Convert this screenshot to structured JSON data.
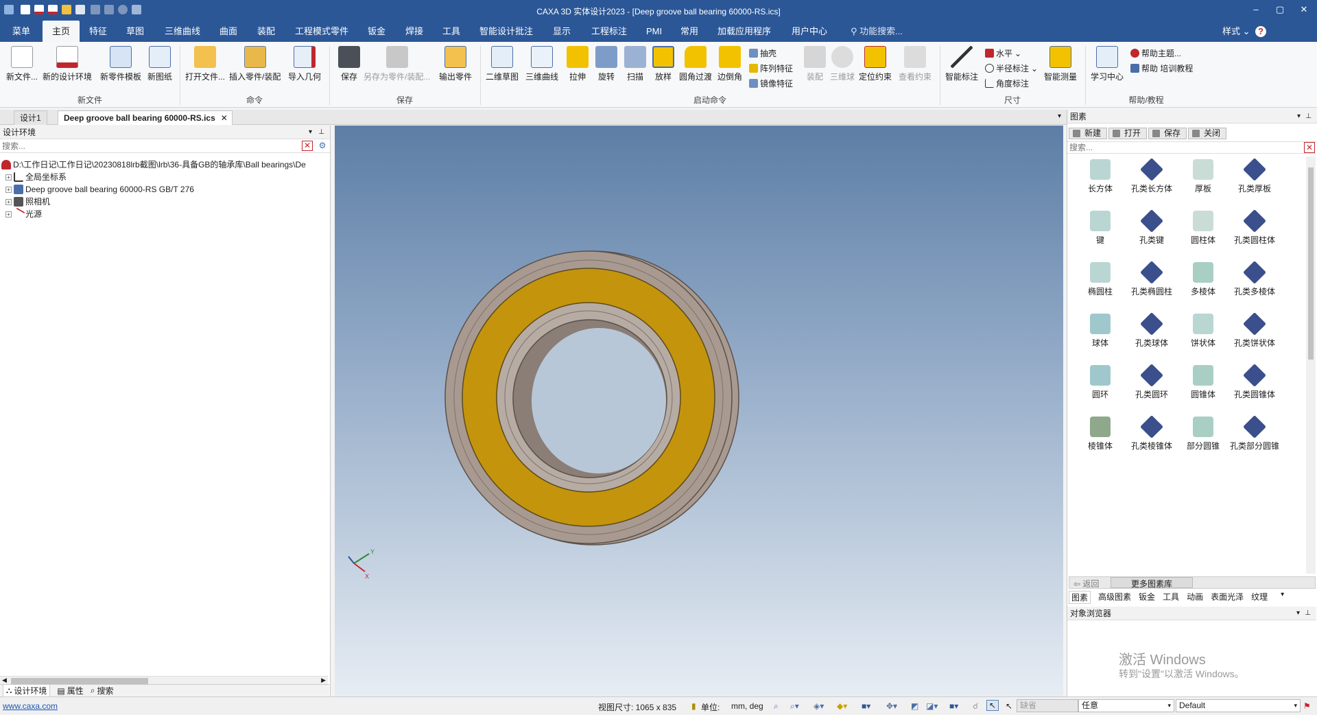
{
  "window": {
    "title": "CAXA 3D 实体设计2023 - [Deep groove ball bearing 60000-RS.ics]",
    "controls": [
      "–",
      "▢",
      "✕"
    ]
  },
  "menu": {
    "tabs": [
      "菜单",
      "主页",
      "特征",
      "草图",
      "三维曲线",
      "曲面",
      "装配",
      "工程模式零件",
      "钣金",
      "焊接",
      "工具",
      "智能设计批注",
      "显示",
      "工程标注",
      "PMI",
      "常用",
      "加载应用程序",
      "用户中心"
    ],
    "active_tab": "主页",
    "search_placeholder": "功能搜索...",
    "style_label": "样式"
  },
  "ribbon": {
    "buttons": {
      "new_file": "新文件...",
      "new_design_env": "新的设计环境",
      "new_part_template": "新零件模板",
      "new_drawing": "新图纸",
      "open_file": "打开文件...",
      "insert_part": "插入零件/装配",
      "import_geometry": "导入几何",
      "save": "保存",
      "save_as_part": "另存为零件/装配...",
      "export_part": "输出零件",
      "sketch_2d": "二维草图",
      "curve_3d": "三维曲线",
      "extrude": "拉伸",
      "revolve": "旋转",
      "sweep": "扫描",
      "loft": "放样",
      "fillet": "圆角过渡",
      "chamfer": "边倒角",
      "shell": "抽壳",
      "pattern": "阵列特征",
      "mirror": "镜像特征",
      "assembly": "装配",
      "ball_3d": "三维球",
      "position_constraint": "定位约束",
      "view_constraint": "查看约束",
      "smart_dimension": "智能标注",
      "horizontal": "水平",
      "radius_dim": "半径标注",
      "angle_dim": "角度标注",
      "smart_measure": "智能测量",
      "learning_center": "学习中心",
      "help_topics": "帮助主题...",
      "help_training": "帮助 培训教程"
    },
    "groups": {
      "new_file": "新文件",
      "command": "命令",
      "save": "保存",
      "launch": "启动命令",
      "dimension": "尺寸",
      "help": "帮助/教程"
    }
  },
  "doc_tabs": [
    {
      "label": "设计1",
      "active": false
    },
    {
      "label": "Deep groove ball bearing 60000-RS.ics",
      "active": true
    }
  ],
  "left_panel": {
    "title": "设计环境",
    "search_placeholder": "搜索...",
    "tree": [
      "D:\\工作日记\\工作日记\\20230818lrb截图\\lrb\\36-具备GB的轴承库\\Ball bearings\\De",
      "全局坐标系",
      "Deep groove ball bearing 60000-RS GB/T 276",
      "照相机",
      "光源"
    ],
    "footer_tabs": [
      "设计环境",
      "属性",
      "搜索"
    ]
  },
  "right_panel": {
    "title": "图素",
    "buttons": [
      "新建",
      "打开",
      "保存",
      "关闭"
    ],
    "search_placeholder": "搜索...",
    "items": [
      {
        "label": "长方体",
        "color": "#b9d6d3"
      },
      {
        "label": "孔类长方体",
        "color": "#3b4f8c"
      },
      {
        "label": "厚板",
        "color": "#c9ddd6"
      },
      {
        "label": "孔类厚板",
        "color": "#3b4f8c"
      },
      {
        "label": "键",
        "color": "#b9d6d3"
      },
      {
        "label": "孔类键",
        "color": "#3b4f8c"
      },
      {
        "label": "圆柱体",
        "color": "#c9ddd6"
      },
      {
        "label": "孔类圆柱体",
        "color": "#3b4f8c"
      },
      {
        "label": "椭圆柱",
        "color": "#b9d6d3"
      },
      {
        "label": "孔类椭圆柱",
        "color": "#3b4f8c"
      },
      {
        "label": "多棱体",
        "color": "#a9cfc4"
      },
      {
        "label": "孔类多棱体",
        "color": "#3b4f8c"
      },
      {
        "label": "球体",
        "color": "#9fc8cc"
      },
      {
        "label": "孔类球体",
        "color": "#3b4f8c"
      },
      {
        "label": "饼状体",
        "color": "#b9d6d3"
      },
      {
        "label": "孔类饼状体",
        "color": "#3b4f8c"
      },
      {
        "label": "圆环",
        "color": "#9fc8cc"
      },
      {
        "label": "孔类圆环",
        "color": "#3b4f8c"
      },
      {
        "label": "圆锥体",
        "color": "#a9cfc4"
      },
      {
        "label": "孔类圆锥体",
        "color": "#3b4f8c"
      },
      {
        "label": "棱锥体",
        "color": "#8fa88c"
      },
      {
        "label": "孔类棱锥体",
        "color": "#3b4f8c"
      },
      {
        "label": "部分圆锥",
        "color": "#a9cfc4"
      },
      {
        "label": "孔类部分圆锥",
        "color": "#3b4f8c"
      }
    ],
    "back_label": "返回",
    "more_label": "更多图素库",
    "bottom_tabs": [
      "图素",
      "高级图素",
      "钣金",
      "工具",
      "动画",
      "表面光泽",
      "纹理"
    ],
    "browser_title": "对象浏览器"
  },
  "viewport": {
    "axis_labels": {
      "y": "Y",
      "x": "X"
    },
    "bearing_colors": {
      "outer": "#a89a90",
      "seal": "#c4940d",
      "inner": "#b7aca4"
    }
  },
  "status": {
    "url": "www.caxa.com",
    "view_size": "视图尺寸: 1065 x  835",
    "unit_label": "单位:",
    "unit_value": "mm, deg",
    "default_field": "缺省",
    "any_field": "任意",
    "default_select": "Default"
  },
  "watermark": {
    "line1": "激活 Windows",
    "line2": "转到\"设置\"以激活 Windows。"
  }
}
